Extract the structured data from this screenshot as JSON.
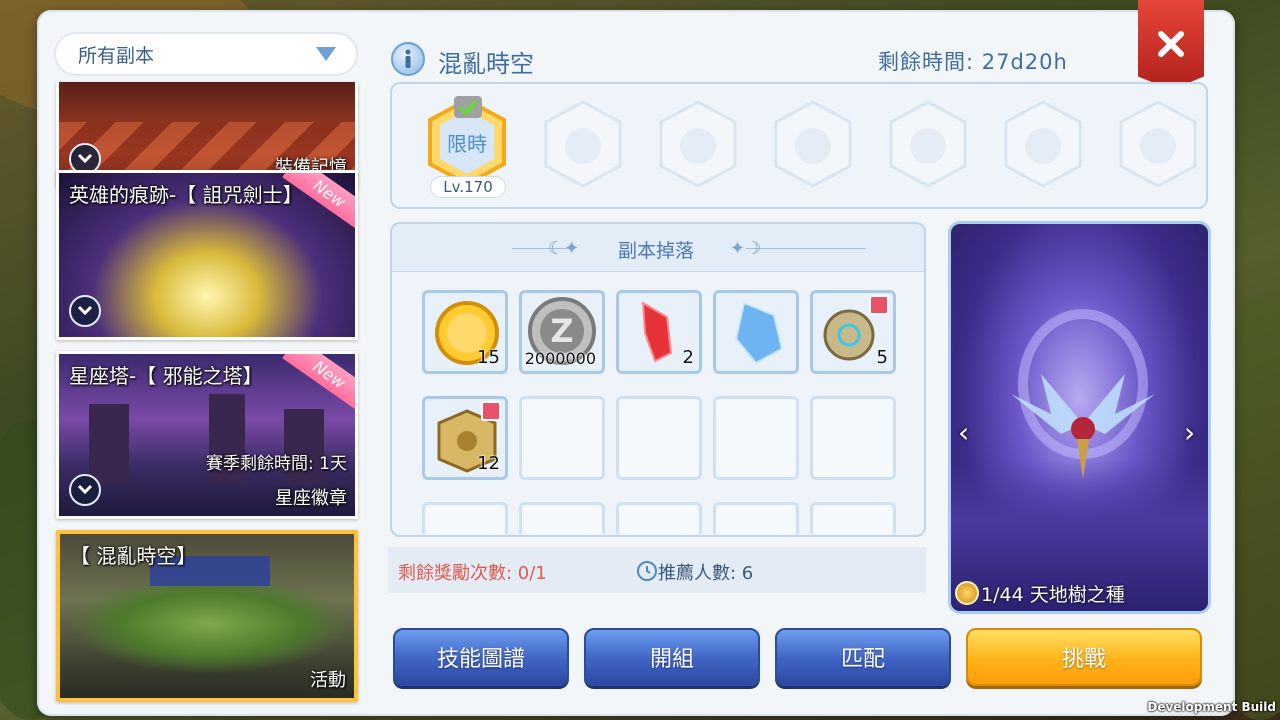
{
  "filter": {
    "label": "所有副本"
  },
  "dungeon_list": [
    {
      "title": "",
      "tag": "裝備記憶",
      "new": false,
      "selected": false
    },
    {
      "title": "英雄的痕跡-【 詛咒劍士】",
      "tag": "",
      "new": true,
      "new_label": "New",
      "selected": false
    },
    {
      "title": "星座塔-【 邪能之塔】",
      "season_remain": "賽季剩餘時間: 1天",
      "tag": "星座徽章",
      "new": true,
      "new_label": "New",
      "selected": false
    },
    {
      "title": "【 混亂時空】",
      "tag": "活動",
      "new": false,
      "selected": true
    }
  ],
  "header": {
    "title": "混亂時空",
    "remaining_time": "剩餘時間: 27d20h"
  },
  "levels": {
    "current_label": "限時",
    "current_level": "Lv.170"
  },
  "drops": {
    "title": "副本掉落",
    "items": [
      {
        "name": "gold-cat-coin-icon",
        "count": "15"
      },
      {
        "name": "zeny-coin-icon",
        "count": "2000000"
      },
      {
        "name": "red-crystal-icon",
        "count": "2"
      },
      {
        "name": "blue-crystal-icon",
        "count": ""
      },
      {
        "name": "gear-scope-icon",
        "count": "5",
        "shop": true
      },
      {
        "name": "gold-cube-icon",
        "count": "12",
        "shop": true
      }
    ]
  },
  "status": {
    "reward_left": "剩餘獎勵次數: 0/1",
    "recommended": "推薦人數: 6"
  },
  "preview": {
    "caption": "1/44 天地樹之種"
  },
  "buttons": {
    "skill_map": "技能圖譜",
    "team": "開組",
    "match": "匹配",
    "challenge": "挑戰"
  },
  "watermark": "Development Build"
}
